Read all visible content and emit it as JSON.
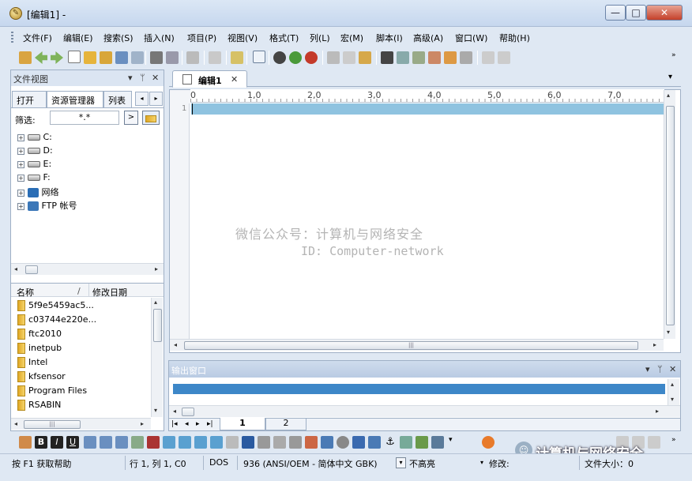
{
  "window": {
    "title": "[编辑1] -",
    "app_icon": "notepad-icon",
    "minimize": "—",
    "maximize": "□",
    "close": "✕"
  },
  "menu": [
    "文件(F)",
    "编辑(E)",
    "搜索(S)",
    "插入(N)",
    "项目(P)",
    "视图(V)",
    "格式(T)",
    "列(L)",
    "宏(M)",
    "脚本(I)",
    "高级(A)",
    "窗口(W)",
    "帮助(H)"
  ],
  "file_view": {
    "title": "文件视图",
    "tabs": [
      "打开",
      "资源管理器",
      "列表"
    ],
    "filter_label": "筛选:",
    "filter_value": "*.*",
    "tree": [
      {
        "label": "C:",
        "icon": "drive-icon"
      },
      {
        "label": "D:",
        "icon": "drive-icon"
      },
      {
        "label": "E:",
        "icon": "drive-icon"
      },
      {
        "label": "F:",
        "icon": "drive-icon"
      },
      {
        "label": "网络",
        "icon": "network-icon"
      },
      {
        "label": "FTP 帐号",
        "icon": "ftp-icon"
      }
    ],
    "columns": [
      "名称",
      "修改日期"
    ],
    "sort_indicator": "/",
    "files": [
      "5f9e5459ac5...",
      "c03744e220e...",
      "ftc2010",
      "inetpub",
      "Intel",
      "kfsensor",
      "Program Files",
      "RSABIN"
    ]
  },
  "editor": {
    "tab_label": "编辑1",
    "ruler": [
      "0",
      "1,0",
      "2,0",
      "3,0",
      "4,0",
      "5,0",
      "6,0",
      "7,0"
    ],
    "line_number": "1",
    "watermark_line1": "微信公众号：计算机与网络安全",
    "watermark_line2": "ID: Computer-network"
  },
  "output": {
    "title": "输出窗口",
    "tabs": [
      "1",
      "2"
    ]
  },
  "status": {
    "help": "按 F1 获取帮助",
    "position": "行 1, 列 1, C0",
    "format": "DOS",
    "encoding": "936  (ANSI/OEM - 简体中文 GBK)",
    "highlight": "不高亮",
    "modified": "修改:",
    "filesize": "文件大小：0"
  },
  "overlay": {
    "wechat_brand": "计算机与网络安全"
  },
  "colors": {
    "accent_blue": "#3d87c8",
    "current_line": "#8fc3e0"
  }
}
